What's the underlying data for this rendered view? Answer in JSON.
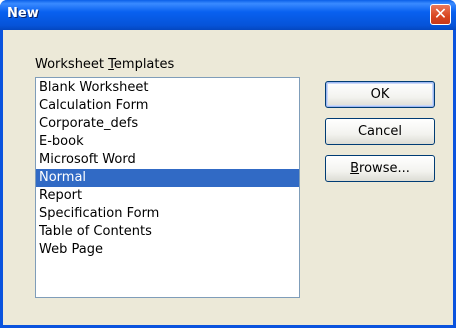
{
  "window": {
    "title": "New",
    "close_glyph": "✕"
  },
  "templates_label": {
    "accel": "T",
    "rest_before": "Worksheet ",
    "rest_after": "emplates"
  },
  "templates": [
    {
      "label": "Blank Worksheet",
      "selected": false
    },
    {
      "label": "Calculation Form",
      "selected": false
    },
    {
      "label": "Corporate_defs",
      "selected": false
    },
    {
      "label": "E-book",
      "selected": false
    },
    {
      "label": "Microsoft Word",
      "selected": false
    },
    {
      "label": "Normal",
      "selected": true
    },
    {
      "label": "Report",
      "selected": false
    },
    {
      "label": "Specification Form",
      "selected": false
    },
    {
      "label": "Table of Contents",
      "selected": false
    },
    {
      "label": "Web Page",
      "selected": false
    }
  ],
  "buttons": {
    "ok": "OK",
    "cancel": "Cancel",
    "browse_accel": "B",
    "browse_rest": "rowse..."
  },
  "colors": {
    "title_bar": "#0653d8",
    "selection": "#316ac5",
    "dialog_bg": "#ece9d8",
    "close_button": "#d9451f"
  },
  "icons": {
    "close": "close-icon"
  }
}
